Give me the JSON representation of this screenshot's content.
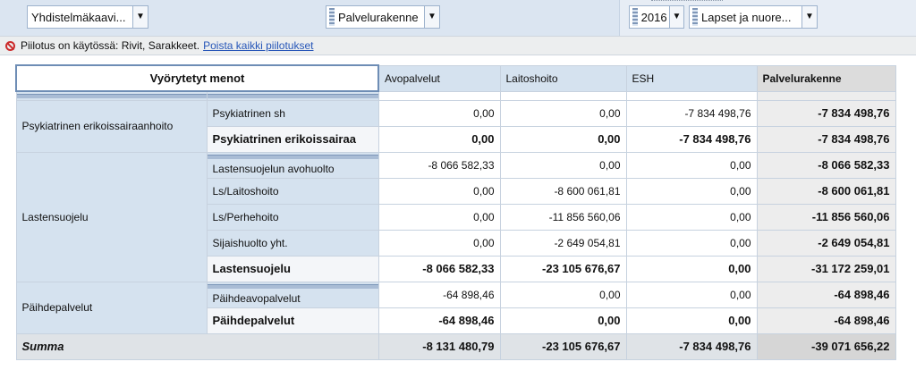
{
  "toolbar": {
    "filter1": "Yhdistelmäkaavi...",
    "filter2": "Palvelurakenne",
    "year": "2016",
    "group": "Lapset ja nuore..."
  },
  "notice": {
    "text": "Piilotus on käytössä: Rivit, Sarakkeet.",
    "link": "Poista kaikki piilotukset"
  },
  "table": {
    "corner": "Vyörytetyt menot",
    "columns": [
      "Avopalvelut",
      "Laitoshoito",
      "ESH",
      "Palvelurakenne"
    ],
    "groups": [
      {
        "name": "Psykiatrinen erikoissairaanhoito",
        "rows": [
          {
            "label": "Psykiatrinen sh",
            "values": [
              "0,00",
              "0,00",
              "-7 834 498,76",
              "-7 834 498,76"
            ]
          },
          {
            "label": "Psykiatrinen erikoissairaa",
            "values": [
              "0,00",
              "0,00",
              "-7 834 498,76",
              "-7 834 498,76"
            ],
            "subtotal": true
          }
        ]
      },
      {
        "name": "Lastensuojelu",
        "rows": [
          {
            "label": "Lastensuojelun avohuolto",
            "values": [
              "-8 066 582,33",
              "0,00",
              "0,00",
              "-8 066 582,33"
            ]
          },
          {
            "label": "Ls/Laitoshoito",
            "values": [
              "0,00",
              "-8 600 061,81",
              "0,00",
              "-8 600 061,81"
            ]
          },
          {
            "label": "Ls/Perhehoito",
            "values": [
              "0,00",
              "-11 856 560,06",
              "0,00",
              "-11 856 560,06"
            ]
          },
          {
            "label": "Sijaishuolto yht.",
            "values": [
              "0,00",
              "-2 649 054,81",
              "0,00",
              "-2 649 054,81"
            ]
          },
          {
            "label": "Lastensuojelu",
            "values": [
              "-8 066 582,33",
              "-23 105 676,67",
              "0,00",
              "-31 172 259,01"
            ],
            "subtotal": true
          }
        ]
      },
      {
        "name": "Päihdepalvelut",
        "rows": [
          {
            "label": "Päihdeavopalvelut",
            "values": [
              "-64 898,46",
              "0,00",
              "0,00",
              "-64 898,46"
            ]
          },
          {
            "label": "Päihdepalvelut",
            "values": [
              "-64 898,46",
              "0,00",
              "0,00",
              "-64 898,46"
            ],
            "subtotal": true
          }
        ]
      }
    ],
    "summary": {
      "label": "Summa",
      "values": [
        "-8 131 480,79",
        "-23 105 676,67",
        "-7 834 498,76",
        "-39 071 656,22"
      ]
    }
  }
}
